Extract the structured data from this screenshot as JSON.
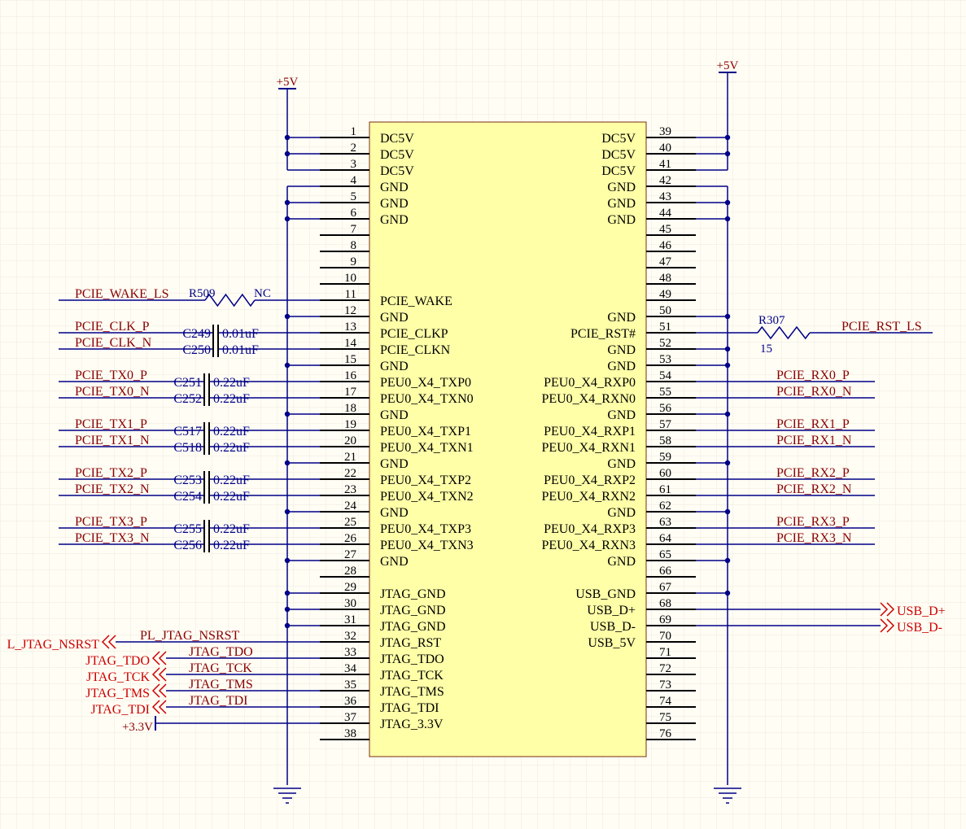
{
  "colors": {
    "background": "#FFFDF4",
    "grid": "#EEECE0",
    "body_fill": "#FFFFA8",
    "body_stroke": "#7A2E0E",
    "wire": "#000088",
    "pin_line": "#000000",
    "pin_name": "#000000",
    "net_label": "#880000",
    "designator": "#000088",
    "port": "#CC0000"
  },
  "component": {
    "left_pins": [
      {
        "num": "1",
        "name": "DC5V"
      },
      {
        "num": "2",
        "name": "DC5V"
      },
      {
        "num": "3",
        "name": "DC5V"
      },
      {
        "num": "4",
        "name": "GND"
      },
      {
        "num": "5",
        "name": "GND"
      },
      {
        "num": "6",
        "name": "GND"
      },
      {
        "num": "7",
        "name": ""
      },
      {
        "num": "8",
        "name": ""
      },
      {
        "num": "9",
        "name": ""
      },
      {
        "num": "10",
        "name": ""
      },
      {
        "num": "11",
        "name": "PCIE_WAKE"
      },
      {
        "num": "12",
        "name": "GND"
      },
      {
        "num": "13",
        "name": "PCIE_CLKP"
      },
      {
        "num": "14",
        "name": "PCIE_CLKN"
      },
      {
        "num": "15",
        "name": "GND"
      },
      {
        "num": "16",
        "name": "PEU0_X4_TXP0"
      },
      {
        "num": "17",
        "name": "PEU0_X4_TXN0"
      },
      {
        "num": "18",
        "name": "GND"
      },
      {
        "num": "19",
        "name": "PEU0_X4_TXP1"
      },
      {
        "num": "20",
        "name": "PEU0_X4_TXN1"
      },
      {
        "num": "21",
        "name": "GND"
      },
      {
        "num": "22",
        "name": "PEU0_X4_TXP2"
      },
      {
        "num": "23",
        "name": "PEU0_X4_TXN2"
      },
      {
        "num": "24",
        "name": "GND"
      },
      {
        "num": "25",
        "name": "PEU0_X4_TXP3"
      },
      {
        "num": "26",
        "name": "PEU0_X4_TXN3"
      },
      {
        "num": "27",
        "name": "GND"
      },
      {
        "num": "28",
        "name": ""
      },
      {
        "num": "29",
        "name": "JTAG_GND"
      },
      {
        "num": "30",
        "name": "JTAG_GND"
      },
      {
        "num": "31",
        "name": "JTAG_GND"
      },
      {
        "num": "32",
        "name": "JTAG_RST"
      },
      {
        "num": "33",
        "name": "JTAG_TDO"
      },
      {
        "num": "34",
        "name": "JTAG_TCK"
      },
      {
        "num": "35",
        "name": "JTAG_TMS"
      },
      {
        "num": "36",
        "name": "JTAG_TDI"
      },
      {
        "num": "37",
        "name": "JTAG_3.3V"
      },
      {
        "num": "38",
        "name": ""
      }
    ],
    "right_pins": [
      {
        "num": "39",
        "name": "DC5V"
      },
      {
        "num": "40",
        "name": "DC5V"
      },
      {
        "num": "41",
        "name": "DC5V"
      },
      {
        "num": "42",
        "name": "GND"
      },
      {
        "num": "43",
        "name": "GND"
      },
      {
        "num": "44",
        "name": "GND"
      },
      {
        "num": "45",
        "name": ""
      },
      {
        "num": "46",
        "name": ""
      },
      {
        "num": "47",
        "name": ""
      },
      {
        "num": "48",
        "name": ""
      },
      {
        "num": "49",
        "name": ""
      },
      {
        "num": "50",
        "name": "GND"
      },
      {
        "num": "51",
        "name": "PCIE_RST#"
      },
      {
        "num": "52",
        "name": "GND"
      },
      {
        "num": "53",
        "name": "GND"
      },
      {
        "num": "54",
        "name": "PEU0_X4_RXP0"
      },
      {
        "num": "55",
        "name": "PEU0_X4_RXN0"
      },
      {
        "num": "56",
        "name": "GND"
      },
      {
        "num": "57",
        "name": "PEU0_X4_RXP1"
      },
      {
        "num": "58",
        "name": "PEU0_X4_RXN1"
      },
      {
        "num": "59",
        "name": "GND"
      },
      {
        "num": "60",
        "name": "PEU0_X4_RXP2"
      },
      {
        "num": "61",
        "name": "PEU0_X4_RXN2"
      },
      {
        "num": "62",
        "name": "GND"
      },
      {
        "num": "63",
        "name": "PEU0_X4_RXP3"
      },
      {
        "num": "64",
        "name": "PEU0_X4_RXN3"
      },
      {
        "num": "65",
        "name": "GND"
      },
      {
        "num": "66",
        "name": ""
      },
      {
        "num": "67",
        "name": "USB_GND"
      },
      {
        "num": "68",
        "name": "USB_D+"
      },
      {
        "num": "69",
        "name": "USB_D-"
      },
      {
        "num": "70",
        "name": "USB_5V"
      },
      {
        "num": "71",
        "name": ""
      },
      {
        "num": "72",
        "name": ""
      },
      {
        "num": "73",
        "name": ""
      },
      {
        "num": "74",
        "name": ""
      },
      {
        "num": "75",
        "name": ""
      },
      {
        "num": "76",
        "name": ""
      }
    ]
  },
  "power": {
    "left_rail": "+5V",
    "right_rail": "+5V",
    "jtag_supply": "+3.3V"
  },
  "resistors": [
    {
      "ref": "R509",
      "value": "NC"
    },
    {
      "ref": "R307",
      "value": "15"
    }
  ],
  "capacitors": [
    {
      "ref": "C249",
      "value": "0.01uF"
    },
    {
      "ref": "C250",
      "value": "0.01uF"
    },
    {
      "ref": "C251",
      "value": "0.22uF"
    },
    {
      "ref": "C252",
      "value": "0.22uF"
    },
    {
      "ref": "C517",
      "value": "0.22uF"
    },
    {
      "ref": "C518",
      "value": "0.22uF"
    },
    {
      "ref": "C253",
      "value": "0.22uF"
    },
    {
      "ref": "C254",
      "value": "0.22uF"
    },
    {
      "ref": "C255",
      "value": "0.22uF"
    },
    {
      "ref": "C256",
      "value": "0.22uF"
    }
  ],
  "nets_left": [
    "PCIE_WAKE_LS",
    "PCIE_CLK_P",
    "PCIE_CLK_N",
    "PCIE_TX0_P",
    "PCIE_TX0_N",
    "PCIE_TX1_P",
    "PCIE_TX1_N",
    "PCIE_TX2_P",
    "PCIE_TX2_N",
    "PCIE_TX3_P",
    "PCIE_TX3_N"
  ],
  "nets_right": [
    "PCIE_RST_LS",
    "PCIE_RX0_P",
    "PCIE_RX0_N",
    "PCIE_RX1_P",
    "PCIE_RX1_N",
    "PCIE_RX2_P",
    "PCIE_RX2_N",
    "PCIE_RX3_P",
    "PCIE_RX3_N"
  ],
  "jtag_nets": [
    "PL_JTAG_NSRST",
    "JTAG_TDO",
    "JTAG_TCK",
    "JTAG_TMS",
    "JTAG_TDI"
  ],
  "ports_left": [
    "L_JTAG_NSRST",
    "JTAG_TDO",
    "JTAG_TCK",
    "JTAG_TMS",
    "JTAG_TDI"
  ],
  "ports_right": [
    "USB_D+",
    "USB_D-"
  ]
}
